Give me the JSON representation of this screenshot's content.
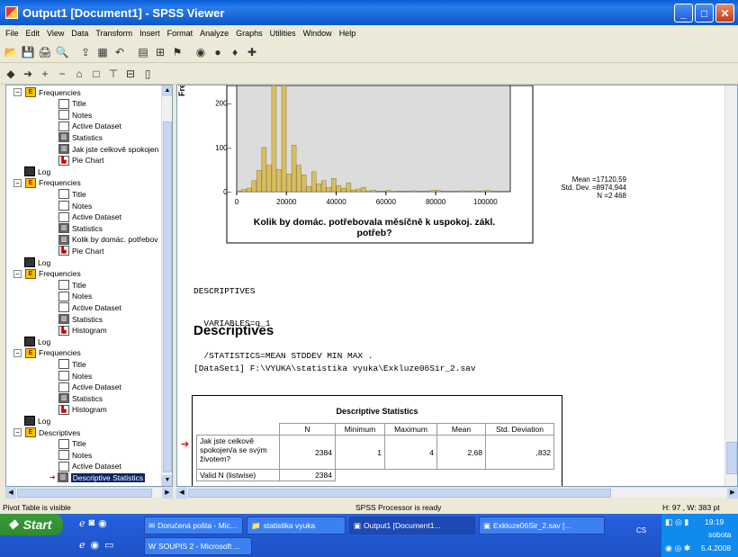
{
  "window": {
    "title": "Output1 [Document1] - SPSS Viewer",
    "min": "_",
    "max": "□",
    "close": "✕"
  },
  "menu": [
    "File",
    "Edit",
    "View",
    "Data",
    "Transform",
    "Insert",
    "Format",
    "Analyze",
    "Graphs",
    "Utilities",
    "Window",
    "Help"
  ],
  "tree": [
    {
      "label": "Frequencies",
      "kind": "book",
      "indent": 1,
      "exp": "−"
    },
    {
      "label": "Title",
      "kind": "doc",
      "indent": 2
    },
    {
      "label": "Notes",
      "kind": "doc",
      "indent": 2
    },
    {
      "label": "Active Dataset",
      "kind": "doc",
      "indent": 2
    },
    {
      "label": "Statistics",
      "kind": "stat",
      "indent": 2
    },
    {
      "label": "Jak jste celkově spokojen",
      "kind": "stat",
      "indent": 2
    },
    {
      "label": "Pie Chart",
      "kind": "chart",
      "indent": 2
    },
    {
      "label": "Log",
      "kind": "log",
      "indent": 1
    },
    {
      "label": "Frequencies",
      "kind": "book",
      "indent": 1,
      "exp": "−"
    },
    {
      "label": "Title",
      "kind": "doc",
      "indent": 2
    },
    {
      "label": "Notes",
      "kind": "doc",
      "indent": 2
    },
    {
      "label": "Active Dataset",
      "kind": "doc",
      "indent": 2
    },
    {
      "label": "Statistics",
      "kind": "stat",
      "indent": 2
    },
    {
      "label": "Kolik by domác. potřebov",
      "kind": "stat",
      "indent": 2
    },
    {
      "label": "Pie Chart",
      "kind": "chart",
      "indent": 2
    },
    {
      "label": "Log",
      "kind": "log",
      "indent": 1
    },
    {
      "label": "Frequencies",
      "kind": "book",
      "indent": 1,
      "exp": "−"
    },
    {
      "label": "Title",
      "kind": "doc",
      "indent": 2
    },
    {
      "label": "Notes",
      "kind": "doc",
      "indent": 2
    },
    {
      "label": "Active Dataset",
      "kind": "doc",
      "indent": 2
    },
    {
      "label": "Statistics",
      "kind": "stat",
      "indent": 2
    },
    {
      "label": "Histogram",
      "kind": "chart",
      "indent": 2
    },
    {
      "label": "Log",
      "kind": "log",
      "indent": 1
    },
    {
      "label": "Frequencies",
      "kind": "book",
      "indent": 1,
      "exp": "−"
    },
    {
      "label": "Title",
      "kind": "doc",
      "indent": 2
    },
    {
      "label": "Notes",
      "kind": "doc",
      "indent": 2
    },
    {
      "label": "Active Dataset",
      "kind": "doc",
      "indent": 2
    },
    {
      "label": "Statistics",
      "kind": "stat",
      "indent": 2
    },
    {
      "label": "Histogram",
      "kind": "chart",
      "indent": 2
    },
    {
      "label": "Log",
      "kind": "log",
      "indent": 1
    },
    {
      "label": "Descriptives",
      "kind": "book",
      "indent": 1,
      "exp": "−"
    },
    {
      "label": "Title",
      "kind": "doc",
      "indent": 2
    },
    {
      "label": "Notes",
      "kind": "doc",
      "indent": 2
    },
    {
      "label": "Active Dataset",
      "kind": "doc",
      "indent": 2
    },
    {
      "label": "Descriptive Statistics",
      "kind": "stat",
      "indent": 2,
      "selected": true
    }
  ],
  "chart": {
    "ylabel": "Fre",
    "yticks": [
      "0",
      "100",
      "200"
    ],
    "xticks": [
      "0",
      "20000",
      "40000",
      "60000",
      "80000",
      "100000"
    ],
    "xlabel_line1": "Kolik by domác. potřebovala měsíčně k uspokoj. zákl.",
    "xlabel_line2": "potřeb?",
    "stats": [
      "Mean =17120,59",
      "Std. Dev. =8974,944",
      "N =2 468"
    ]
  },
  "chart_data": {
    "type": "bar",
    "title": "",
    "xlabel": "Kolik by domác. potřebovala měsíčně k uspokoj. zákl. potřeb?",
    "ylabel": "Fre",
    "xlim": [
      0,
      110000
    ],
    "ylim": [
      0,
      260
    ],
    "bins": [
      {
        "x": 1000,
        "y": 2
      },
      {
        "x": 3000,
        "y": 5
      },
      {
        "x": 5000,
        "y": 8
      },
      {
        "x": 7000,
        "y": 25
      },
      {
        "x": 9000,
        "y": 48
      },
      {
        "x": 11000,
        "y": 100
      },
      {
        "x": 13000,
        "y": 60
      },
      {
        "x": 15000,
        "y": 270
      },
      {
        "x": 17000,
        "y": 50
      },
      {
        "x": 19000,
        "y": 280
      },
      {
        "x": 21000,
        "y": 40
      },
      {
        "x": 23000,
        "y": 105
      },
      {
        "x": 25000,
        "y": 60
      },
      {
        "x": 27000,
        "y": 38
      },
      {
        "x": 29000,
        "y": 12
      },
      {
        "x": 31000,
        "y": 45
      },
      {
        "x": 33000,
        "y": 18
      },
      {
        "x": 35000,
        "y": 25
      },
      {
        "x": 37000,
        "y": 10
      },
      {
        "x": 39000,
        "y": 30
      },
      {
        "x": 41000,
        "y": 14
      },
      {
        "x": 43000,
        "y": 8
      },
      {
        "x": 45000,
        "y": 20
      },
      {
        "x": 47000,
        "y": 4
      },
      {
        "x": 49000,
        "y": 6
      },
      {
        "x": 51000,
        "y": 10
      },
      {
        "x": 53000,
        "y": 2
      },
      {
        "x": 55000,
        "y": 3
      },
      {
        "x": 61000,
        "y": 3
      },
      {
        "x": 63000,
        "y": 1
      },
      {
        "x": 71000,
        "y": 2
      },
      {
        "x": 79000,
        "y": 3
      },
      {
        "x": 81000,
        "y": 3
      },
      {
        "x": 91000,
        "y": 2
      },
      {
        "x": 95000,
        "y": 2
      },
      {
        "x": 99000,
        "y": 2
      },
      {
        "x": 101000,
        "y": 3
      }
    ]
  },
  "syntax": [
    "DESCRIPTIVES",
    "  VARIABLES=q_1",
    "  /STATISTICS=MEAN STDDEV MIN MAX ."
  ],
  "heading": "Descriptives",
  "dataset": "[DataSet1] F:\\VYUKA\\statistika vyuka\\Exkluze06Sir_2.sav",
  "table": {
    "title": "Descriptive Statistics",
    "headers": [
      "",
      "N",
      "Minimum",
      "Maximum",
      "Mean",
      "Std. Deviation"
    ],
    "row1": {
      "label": "Jak jste celkově spokojen/a se svým životem?",
      "n": "2384",
      "min": "1",
      "max": "4",
      "mean": "2,68",
      "sd": ",832"
    },
    "row2": {
      "label": "Valid N (listwise)",
      "n": "2384"
    }
  },
  "status": {
    "left": "Pivot Table is visible",
    "center": "SPSS Processor  is ready",
    "right": "H: 97 , W: 383 pt"
  },
  "taskbar": {
    "start": "Start",
    "tasks": [
      "Doručená pošta - Mic...",
      "statistika vyuka",
      "Output1 [Document1...",
      "Exkluze06Sir_2.sav [...",
      "SOUPIS 2 - Microsoft ..."
    ],
    "lang": "CS",
    "time": "19:19",
    "day": "sobota",
    "date": "5.4.2008"
  }
}
